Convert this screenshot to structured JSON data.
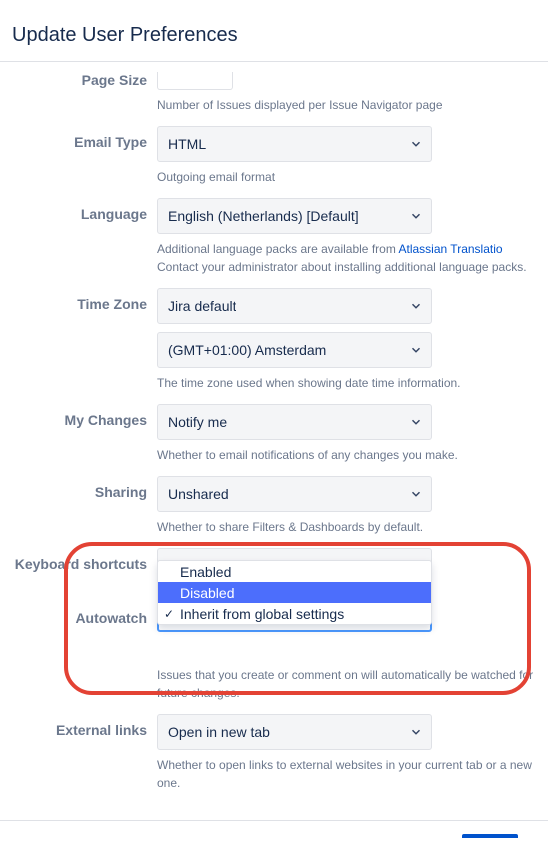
{
  "header": {
    "title": "Update User Preferences"
  },
  "page_size": {
    "label": "Page Size",
    "hint": "Number of Issues displayed per Issue Navigator page"
  },
  "email_type": {
    "label": "Email Type",
    "value": "HTML",
    "hint": "Outgoing email format"
  },
  "language": {
    "label": "Language",
    "value": "English (Netherlands) [Default]",
    "hint_pre": "Additional language packs are available from ",
    "hint_link": "Atlassian Translatio",
    "hint_post": " Contact your administrator about installing additional language packs."
  },
  "time_zone": {
    "label": "Time Zone",
    "value1": "Jira default",
    "value2": "(GMT+01:00) Amsterdam",
    "hint": "The time zone used when showing date time information."
  },
  "my_changes": {
    "label": "My Changes",
    "value": "Notify me",
    "hint": "Whether to email notifications of any changes you make."
  },
  "sharing": {
    "label": "Sharing",
    "value": "Unshared",
    "hint": "Whether to share Filters & Dashboards by default."
  },
  "keyboard": {
    "label": "Keyboard shortcuts",
    "value": "Enabled"
  },
  "autowatch": {
    "label": "Autowatch",
    "options": [
      "Enabled",
      "Disabled",
      "Inherit from global settings"
    ],
    "hint": "Issues that you create or comment on will automatically be watched for future changes."
  },
  "external_links": {
    "label": "External links",
    "value": "Open in new tab",
    "hint": "Whether to open links to external websites in your current tab or a new one."
  }
}
